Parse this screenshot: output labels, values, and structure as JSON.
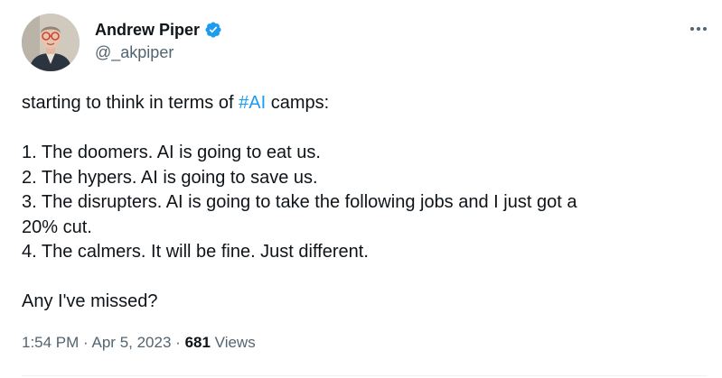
{
  "author": {
    "display_name": "Andrew Piper",
    "handle": "@_akpiper",
    "verified": true
  },
  "more_icon": "more-horizontal-icon",
  "tweet": {
    "intro_prefix": "starting to think in terms of ",
    "hashtag": "#AI",
    "intro_suffix": " camps:",
    "lines": [
      "1. The doomers. AI is going to eat us.",
      "2. The hypers. AI is going to save us.",
      "3. The disrupters. AI is going to take the following jobs and I just got a",
      "20% cut.",
      "4. The calmers. It will be fine. Just different."
    ],
    "closing": "Any I've missed?"
  },
  "meta": {
    "time": "1:54 PM",
    "separator": "·",
    "date": "Apr 5, 2023",
    "views_count": "681",
    "views_label": "Views"
  },
  "colors": {
    "link": "#1d9bf0",
    "text": "#0f1419",
    "secondary": "#536471",
    "verified": "#1d9bf0"
  }
}
